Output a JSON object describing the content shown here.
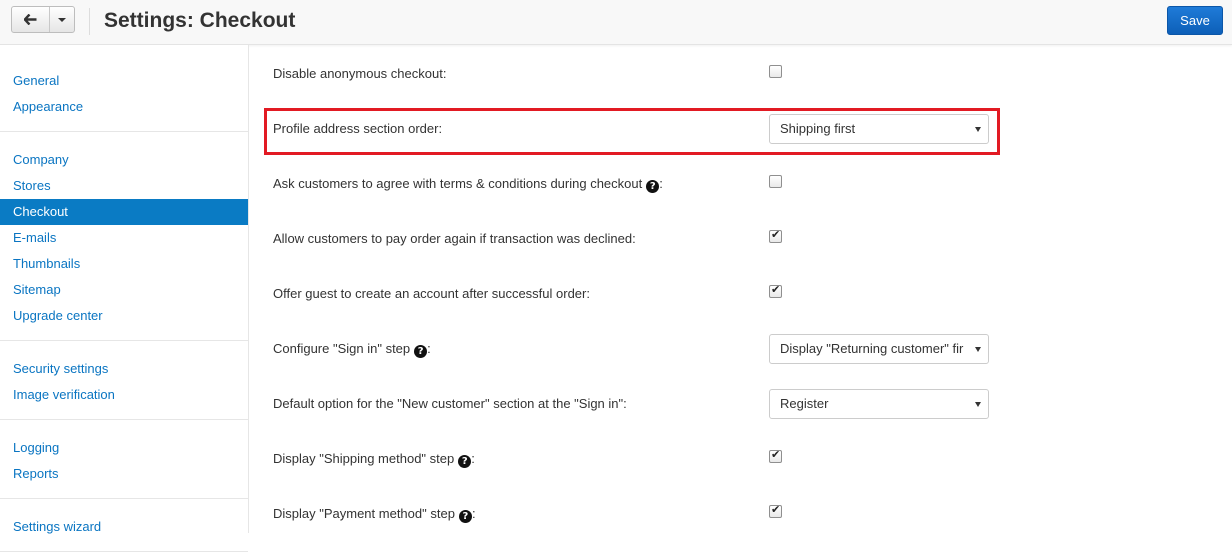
{
  "header": {
    "title": "Settings: Checkout",
    "save_label": "Save",
    "back_icon": "arrow-left-icon",
    "accent": "#0d68c4"
  },
  "sidebar": {
    "groups": [
      {
        "items": [
          {
            "label": "General"
          },
          {
            "label": "Appearance"
          }
        ]
      },
      {
        "items": [
          {
            "label": "Company"
          },
          {
            "label": "Stores"
          },
          {
            "label": "Checkout",
            "active": true
          },
          {
            "label": "E-mails"
          },
          {
            "label": "Thumbnails"
          },
          {
            "label": "Sitemap"
          },
          {
            "label": "Upgrade center"
          }
        ]
      },
      {
        "items": [
          {
            "label": "Security settings"
          },
          {
            "label": "Image verification"
          }
        ]
      },
      {
        "items": [
          {
            "label": "Logging"
          },
          {
            "label": "Reports"
          }
        ]
      },
      {
        "items": [
          {
            "label": "Settings wizard"
          }
        ]
      }
    ]
  },
  "settings": {
    "disable_anonymous": {
      "label": "Disable anonymous checkout:",
      "checked": false
    },
    "profile_address_order": {
      "label": "Profile address section order:",
      "value": "Shipping first"
    },
    "agree_terms": {
      "label": "Ask customers to agree with terms & conditions during checkout",
      "suffix": ":",
      "checked": false
    },
    "pay_again": {
      "label": "Allow customers to pay order again if transaction was declined:",
      "checked": true
    },
    "offer_account": {
      "label": "Offer guest to create an account after successful order:",
      "checked": true
    },
    "sign_in_step": {
      "label": "Configure \"Sign in\" step",
      "suffix": ":",
      "value": "Display \"Returning customer\" fir"
    },
    "new_customer_default": {
      "label": "Default option for the \"New customer\" section at the \"Sign in\":",
      "value": "Register"
    },
    "shipping_step": {
      "label": "Display \"Shipping method\" step",
      "suffix": ":",
      "checked": true
    },
    "payment_step": {
      "label": "Display \"Payment method\" step",
      "suffix": ":",
      "checked": true
    }
  },
  "help_icon_glyph": "?",
  "highlight_color": "#e21a23"
}
